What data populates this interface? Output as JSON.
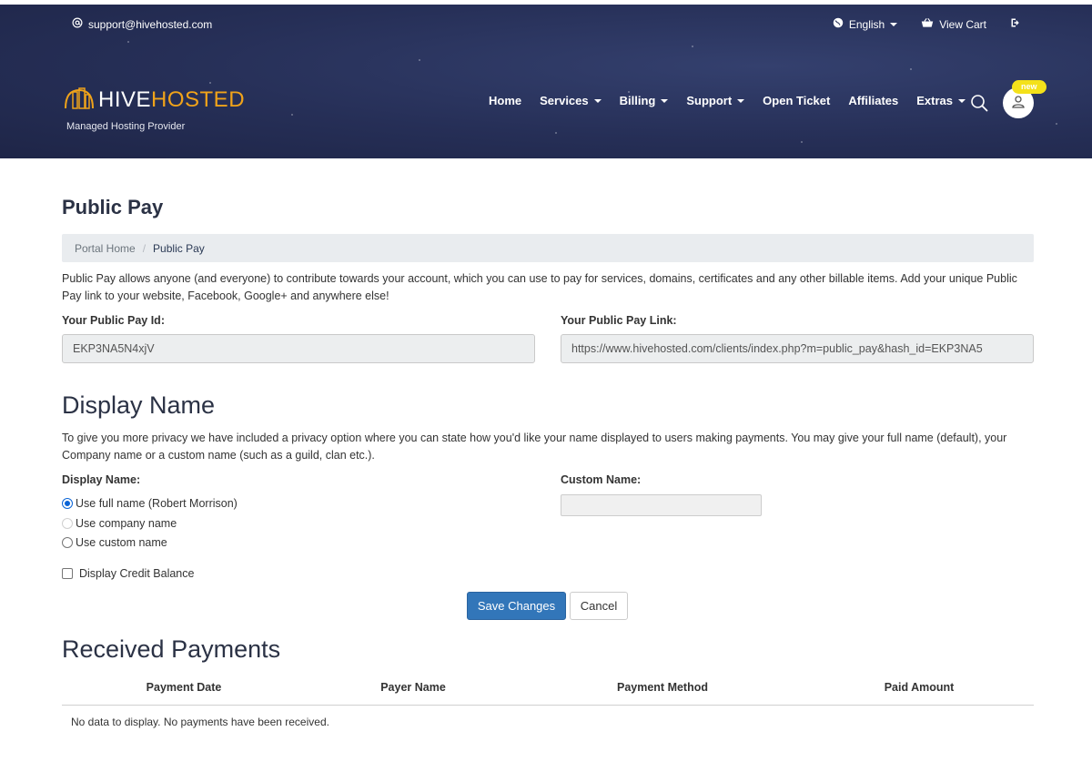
{
  "topbar": {
    "email": "support@hivehosted.com",
    "language": "English",
    "view_cart": "View Cart"
  },
  "brand": {
    "logo_part1": "HIVE",
    "logo_part2": "HOSTED",
    "tagline": "Managed Hosting Provider",
    "accent_color": "#f0a31a"
  },
  "nav": {
    "items": [
      {
        "label": "Home",
        "dropdown": false
      },
      {
        "label": "Services",
        "dropdown": true
      },
      {
        "label": "Billing",
        "dropdown": true
      },
      {
        "label": "Support",
        "dropdown": true
      },
      {
        "label": "Open Ticket",
        "dropdown": false
      },
      {
        "label": "Affiliates",
        "dropdown": false
      },
      {
        "label": "Extras",
        "dropdown": true
      }
    ],
    "badge": "new"
  },
  "page": {
    "title": "Public Pay",
    "breadcrumb": [
      "Portal Home",
      "Public Pay"
    ],
    "intro": "Public Pay allows anyone (and everyone) to contribute towards your account, which you can use to pay for services, domains, certificates and any other billable items. Add your unique Public Pay link to your website, Facebook, Google+ and anywhere else!"
  },
  "public_pay": {
    "id_label": "Your Public Pay Id:",
    "id_value": "EKP3NA5N4xjV",
    "link_label": "Your Public Pay Link:",
    "link_value": "https://www.hivehosted.com/clients/index.php?m=public_pay&hash_id=EKP3NA5"
  },
  "display_name": {
    "heading": "Display Name",
    "description": "To give you more privacy we have included a privacy option where you can state how you'd like your name displayed to users making payments. You may give your full name (default), your Company name or a custom name (such as a guild, clan etc.).",
    "label": "Display Name:",
    "options": [
      {
        "label": "Use full name (Robert Morrison)",
        "state": "checked"
      },
      {
        "label": "Use company name",
        "state": "disabled"
      },
      {
        "label": "Use custom name",
        "state": "unchecked"
      }
    ],
    "custom_label": "Custom Name:",
    "custom_value": "",
    "credit_balance_label": "Display Credit Balance",
    "credit_balance_checked": false,
    "save_label": "Save Changes",
    "cancel_label": "Cancel"
  },
  "received_payments": {
    "heading": "Received Payments",
    "columns": [
      "Payment Date",
      "Payer Name",
      "Payment Method",
      "Paid Amount"
    ],
    "empty_message": "No data to display. No payments have been received."
  }
}
